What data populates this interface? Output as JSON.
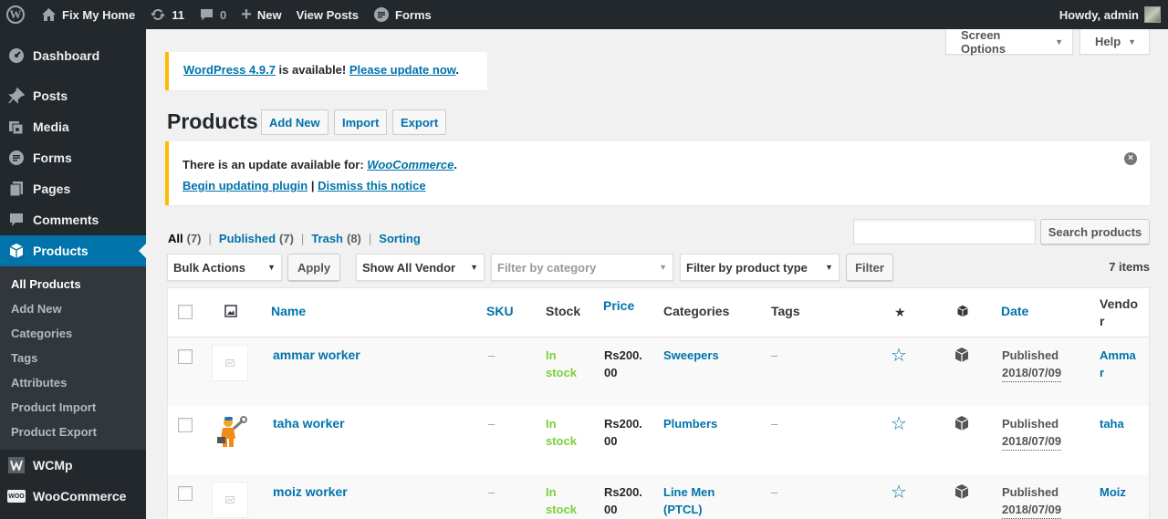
{
  "adminbar": {
    "site_name": "Fix My Home",
    "updates_count": "11",
    "comments_count": "0",
    "new_label": "New",
    "view_posts_label": "View Posts",
    "forms_label": "Forms",
    "howdy": "Howdy, admin"
  },
  "sidebar": {
    "items": [
      {
        "label": "Dashboard",
        "icon": "dashboard-icon"
      },
      {
        "label": "Posts",
        "icon": "pin-icon"
      },
      {
        "label": "Media",
        "icon": "media-icon"
      },
      {
        "label": "Forms",
        "icon": "forms-icon"
      },
      {
        "label": "Pages",
        "icon": "pages-icon"
      },
      {
        "label": "Comments",
        "icon": "comment-icon"
      },
      {
        "label": "Products",
        "icon": "cube-icon"
      },
      {
        "label": "WCMp",
        "icon": "wcmp-icon"
      },
      {
        "label": "WooCommerce",
        "icon": "woo-icon"
      }
    ],
    "submenu": [
      "All Products",
      "Add New",
      "Categories",
      "Tags",
      "Attributes",
      "Product Import",
      "Product Export"
    ],
    "woo_badge": "WOO"
  },
  "screen_options": "Screen Options",
  "help": "Help",
  "notice_wp": {
    "link1": "WordPress 4.9.7",
    "text": " is available! ",
    "link2": "Please update now",
    "end": "."
  },
  "page": {
    "title": "Products",
    "add_new": "Add New",
    "import": "Import",
    "export": "Export"
  },
  "notice_woo": {
    "text": "There is an update available for: ",
    "plugin": "WooCommerce",
    "end": ".",
    "begin": "Begin updating plugin",
    "sep": " | ",
    "dismiss": "Dismiss this notice"
  },
  "views": [
    {
      "label": "All",
      "count": "(7)"
    },
    {
      "label": "Published",
      "count": "(7)"
    },
    {
      "label": "Trash",
      "count": "(8)"
    },
    {
      "label": "Sorting",
      "count": ""
    }
  ],
  "views_sep": "|",
  "search_button": "Search products",
  "filters": {
    "bulk_actions": "Bulk Actions",
    "apply": "Apply",
    "vendor": "Show All Vendor",
    "category_placeholder": "Filter by category",
    "product_type": "Filter by product type",
    "filter": "Filter",
    "items": "7 items"
  },
  "table": {
    "headers": {
      "name": "Name",
      "sku": "SKU",
      "stock": "Stock",
      "price": "Price",
      "categories": "Categories",
      "tags": "Tags",
      "date": "Date",
      "vendor": "Vendo\nr"
    },
    "rows": [
      {
        "name": "ammar worker",
        "sku": "–",
        "stock": "In\nstock",
        "price": "Rs200.\n00",
        "category": "Sweepers",
        "tags": "–",
        "status": "Published",
        "date": "2018/07/09",
        "vendor": "Amma\nr",
        "thumb": "placeholder"
      },
      {
        "name": "taha worker",
        "sku": "–",
        "stock": "In\nstock",
        "price": "Rs200.\n00",
        "category": "Plumbers",
        "tags": "–",
        "status": "Published",
        "date": "2018/07/09",
        "vendor": "taha",
        "thumb": "plumber-image"
      },
      {
        "name": "moiz worker",
        "sku": "–",
        "stock": "In\nstock",
        "price": "Rs200.\n00",
        "category": "Line Men\n(PTCL)",
        "tags": "–",
        "status": "Published",
        "date": "2018/07/09",
        "vendor": "Moiz",
        "thumb": "placeholder"
      }
    ]
  },
  "colors": {
    "adminbar": "#23282d",
    "accent": "#0073aa",
    "notice": "#ffb900",
    "in_stock": "#7ad03a"
  }
}
